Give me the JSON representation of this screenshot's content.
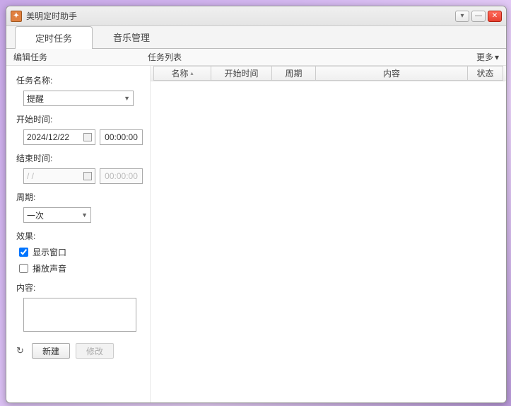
{
  "window": {
    "title": "美明定时助手",
    "buttons": {
      "dropdown": "▾",
      "minimize": "—",
      "close": "✕"
    }
  },
  "tabs": {
    "timed_tasks": "定时任务",
    "music_mgmt": "音乐管理"
  },
  "subheader": {
    "edit_task": "编辑任务",
    "task_list": "任务列表",
    "more": "更多",
    "more_caret": "▾"
  },
  "sidebar": {
    "task_name_label": "任务名称:",
    "task_name_value": "提醒",
    "start_time_label": "开始时间:",
    "start_date": "2024/12/22",
    "start_time": "00:00:00",
    "end_time_label": "结束时间:",
    "end_date": "/   /",
    "end_time": "00:00:00",
    "period_label": "周期:",
    "period_value": "一次",
    "effect_label": "效果:",
    "show_window": "显示窗口",
    "play_sound": "播放声音",
    "content_label": "内容:",
    "content_value": "",
    "refresh_icon": "↻",
    "new_btn": "新建",
    "modify_btn": "修改"
  },
  "columns": {
    "name": "名称",
    "start": "开始时间",
    "period": "周期",
    "content": "内容",
    "status": "状态",
    "sort_caret": "▴"
  }
}
